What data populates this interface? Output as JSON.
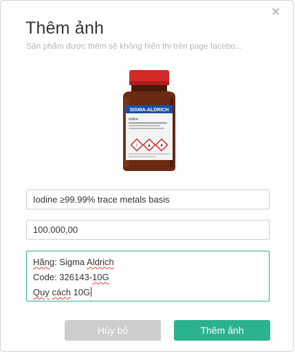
{
  "dialog": {
    "title": "Thêm ảnh",
    "subtitle": "Sản phẩm được thêm sẽ không hiển thị trên page facebo...",
    "close_icon": "×"
  },
  "product": {
    "image_alt": "Sigma-Aldrich iodine bottle",
    "brand_label": "SIGMA-ALDRICH",
    "label_product": "Iodine",
    "name": "Iodine ≥99.99% trace metals basis",
    "price": "100.000,00",
    "description": {
      "line1_prefix": "Hãng",
      "line1_rest": ": Sigma ",
      "line1_brand": "Aldrich",
      "line2_prefix": "Code: 326143-",
      "line2_code": "10G",
      "line3_a": "Quy",
      "line3_b": "cách",
      "line3_rest": " 10G"
    }
  },
  "buttons": {
    "cancel": "Hủy bỏ",
    "submit": "Thêm ảnh"
  },
  "colors": {
    "accent": "#2bb28e",
    "cancel": "#cdcdcd",
    "bottle_cap": "#d42a2a",
    "bottle_glass": "#6b2a12"
  }
}
